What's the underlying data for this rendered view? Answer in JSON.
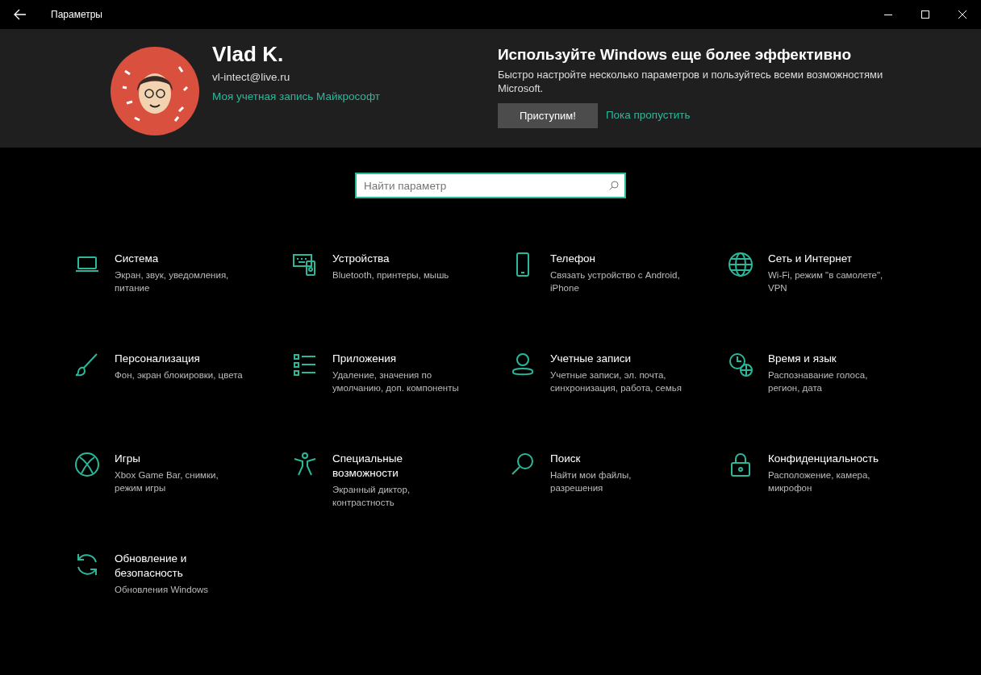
{
  "window": {
    "title": "Параметры"
  },
  "profile": {
    "name": "Vlad K.",
    "email": "vl-intect@live.ru",
    "account_link": "Моя учетная запись Майкрософт"
  },
  "promo": {
    "title": "Используйте Windows еще более эффективно",
    "text": "Быстро настройте несколько параметров и пользуйтесь всеми возможностями Microsoft.",
    "button": "Приступим!",
    "skip_link": "Пока пропустить"
  },
  "search": {
    "placeholder": "Найти параметр"
  },
  "categories": [
    {
      "kind": "laptop",
      "title": "Система",
      "subtitle": "Экран, звук, уведомления, питание"
    },
    {
      "kind": "devices",
      "title": "Устройства",
      "subtitle": "Bluetooth, принтеры, мышь"
    },
    {
      "kind": "phone",
      "title": "Телефон",
      "subtitle": "Связать устройство с Android, iPhone"
    },
    {
      "kind": "globe",
      "title": "Сеть и Интернет",
      "subtitle": "Wi-Fi, режим \"в самолете\", VPN"
    },
    {
      "kind": "brush",
      "title": "Персонализация",
      "subtitle": "Фон, экран блокировки, цвета"
    },
    {
      "kind": "apps",
      "title": "Приложения",
      "subtitle": "Удаление, значения по умолчанию, доп. компоненты"
    },
    {
      "kind": "person",
      "title": "Учетные записи",
      "subtitle": "Учетные записи, эл. почта, синхронизация, работа, семья"
    },
    {
      "kind": "time",
      "title": "Время и язык",
      "subtitle": "Распознавание голоса, регион, дата"
    },
    {
      "kind": "xbox",
      "title": "Игры",
      "subtitle": "Xbox Game Bar, снимки, режим игры"
    },
    {
      "kind": "access",
      "title": "Специальные возможности",
      "subtitle": "Экранный диктор, контрастность"
    },
    {
      "kind": "search",
      "title": "Поиск",
      "subtitle": "Найти мои файлы, разрешения"
    },
    {
      "kind": "lock",
      "title": "Конфиденциальность",
      "subtitle": "Расположение, камера, микрофон"
    },
    {
      "kind": "update",
      "title": "Обновление и безопасность",
      "subtitle": "Обновления Windows"
    }
  ]
}
